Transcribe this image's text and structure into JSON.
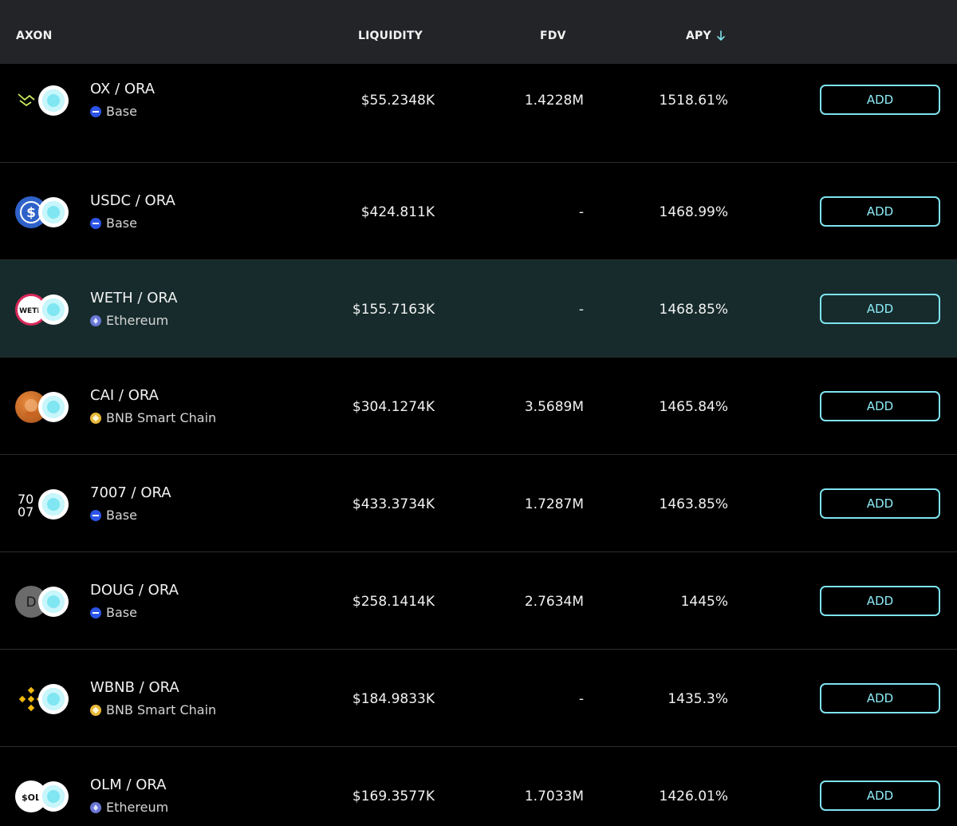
{
  "header": {
    "axon": "AXON",
    "liquidity": "LIQUIDITY",
    "fdv": "FDV",
    "apy": "APY",
    "sort_icon": "arrow-down-icon"
  },
  "colors": {
    "accent": "#7ee3ef",
    "header_bg": "#232427",
    "highlight_row_bg": "#172b2c"
  },
  "rows": [
    {
      "pair": "OX / ORA",
      "chain": "Base",
      "chain_icon": "base",
      "liquidity": "$55.2348K",
      "fdv": "1.4228M",
      "apy": "1518.61%",
      "action": "ADD",
      "token_icon": "ox-icon",
      "highlighted": false
    },
    {
      "pair": "USDC / ORA",
      "chain": "Base",
      "chain_icon": "base",
      "liquidity": "$424.811K",
      "fdv": "-",
      "apy": "1468.99%",
      "action": "ADD",
      "token_icon": "usdc-icon",
      "highlighted": false
    },
    {
      "pair": "WETH / ORA",
      "chain": "Ethereum",
      "chain_icon": "eth",
      "liquidity": "$155.7163K",
      "fdv": "-",
      "apy": "1468.85%",
      "action": "ADD",
      "token_icon": "weth-icon",
      "highlighted": true
    },
    {
      "pair": "CAI / ORA",
      "chain": "BNB Smart Chain",
      "chain_icon": "bnb",
      "liquidity": "$304.1274K",
      "fdv": "3.5689M",
      "apy": "1465.84%",
      "action": "ADD",
      "token_icon": "cai-icon",
      "highlighted": false
    },
    {
      "pair": "7007 / ORA",
      "chain": "Base",
      "chain_icon": "base",
      "liquidity": "$433.3734K",
      "fdv": "1.7287M",
      "apy": "1463.85%",
      "action": "ADD",
      "token_icon": "7007-icon",
      "highlighted": false
    },
    {
      "pair": "DOUG / ORA",
      "chain": "Base",
      "chain_icon": "base",
      "liquidity": "$258.1414K",
      "fdv": "2.7634M",
      "apy": "1445%",
      "action": "ADD",
      "token_icon": "doug-icon",
      "highlighted": false
    },
    {
      "pair": "WBNB / ORA",
      "chain": "BNB Smart Chain",
      "chain_icon": "bnb",
      "liquidity": "$184.9833K",
      "fdv": "-",
      "apy": "1435.3%",
      "action": "ADD",
      "token_icon": "wbnb-icon",
      "highlighted": false
    },
    {
      "pair": "OLM / ORA",
      "chain": "Ethereum",
      "chain_icon": "eth",
      "liquidity": "$169.3577K",
      "fdv": "1.7033M",
      "apy": "1426.01%",
      "action": "ADD",
      "token_icon": "olm-icon",
      "highlighted": false
    }
  ],
  "icon_text": {
    "weth": "WETH",
    "doug": "D",
    "seven": "70\n07",
    "olm": "$OL"
  }
}
